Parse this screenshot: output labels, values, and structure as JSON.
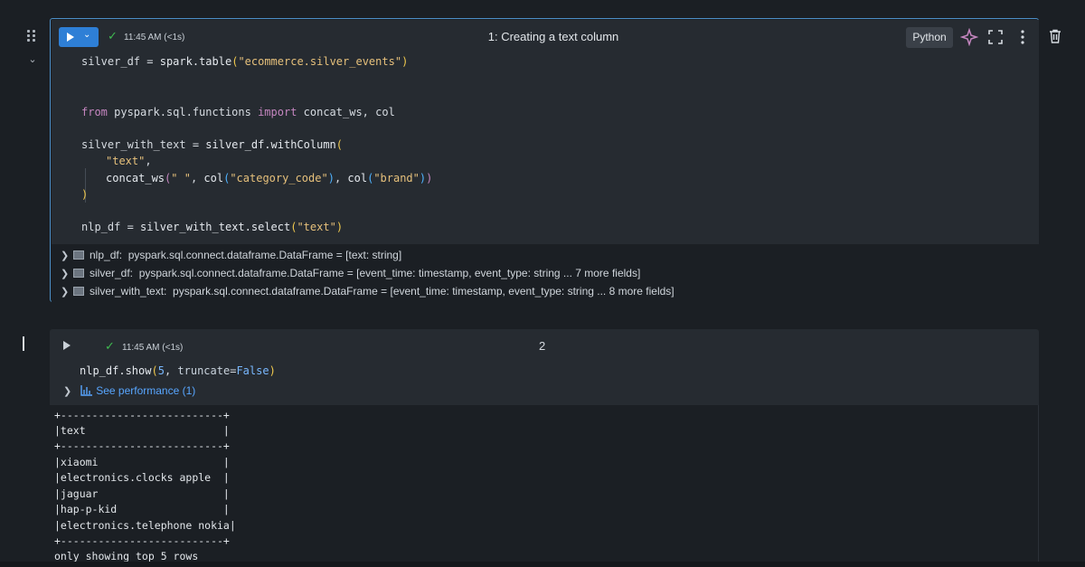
{
  "cell1": {
    "timestamp": "11:45 AM (<1s)",
    "title": "1: Creating a text column",
    "language": "Python",
    "code": {
      "l1": {
        "var": "silver_df",
        "eq": " = ",
        "call": "spark.table",
        "open": "(",
        "arg": "\"ecommerce.silver_events\"",
        "close": ")"
      },
      "l2": {
        "kw_from": "from",
        "module": " pyspark.sql.functions ",
        "kw_import": "import",
        "names": " concat_ws, col"
      },
      "l3": {
        "var": "silver_with_text",
        "eq": " = ",
        "call": "silver_df.withColumn",
        "open": "("
      },
      "l4": {
        "arg": "\"text\"",
        "comma": ","
      },
      "l5": {
        "fn": "concat_ws",
        "open": "(",
        "sep": "\" \"",
        "comma1": ", ",
        "col1": "col",
        "col1_open": "(",
        "col1_arg": "\"category_code\"",
        "col1_close": ")",
        "comma2": ", ",
        "col2": "col",
        "col2_open": "(",
        "col2_arg": "\"brand\"",
        "col2_close": ")",
        "close": ")"
      },
      "l6": {
        "close": ")"
      },
      "l7": {
        "var": "nlp_df",
        "eq": " = ",
        "call": "silver_with_text.select",
        "open": "(",
        "arg": "\"text\"",
        "close": ")"
      }
    },
    "outputs": [
      {
        "name": "nlp_df:",
        "type": "pyspark.sql.connect.dataframe.DataFrame = [text: string]"
      },
      {
        "name": "silver_df:",
        "type": "pyspark.sql.connect.dataframe.DataFrame = [event_time: timestamp, event_type: string ... 7 more fields]"
      },
      {
        "name": "silver_with_text:",
        "type": "pyspark.sql.connect.dataframe.DataFrame = [event_time: timestamp, event_type: string ... 8 more fields]"
      }
    ]
  },
  "cell2": {
    "timestamp": "11:45 AM (<1s)",
    "number": "2",
    "code": {
      "call": "nlp_df.show",
      "open": "(",
      "arg1": "5",
      "comma": ", ",
      "kw": "truncate",
      "eq": "=",
      "val": "False",
      "close": ")"
    },
    "perf_label": "See performance (1)"
  },
  "result_lines": [
    "+--------------------------+",
    "|text                      |",
    "+--------------------------+",
    "|xiaomi                    |",
    "|electronics.clocks apple  |",
    "|jaguar                    |",
    "|hap-p-kid                 |",
    "|electronics.telephone nokia|",
    "+--------------------------+",
    "only showing top 5 rows"
  ],
  "icons": {
    "drag": "drag-handle-icon",
    "collapse": "chevron-down-icon",
    "assistant": "sparkle-icon",
    "fullscreen": "expand-icon",
    "menu": "kebab-menu-icon",
    "delete": "trash-icon"
  },
  "colors": {
    "accent": "#2e7fd6",
    "success": "#3fb950",
    "link": "#58a6ff",
    "cell_border": "#4c8fc7"
  }
}
